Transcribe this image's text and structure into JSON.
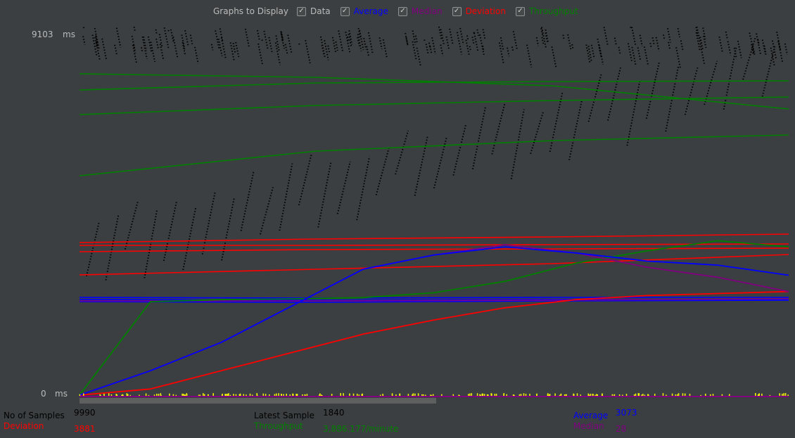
{
  "toolbar": {
    "title": "Graphs to Display",
    "options": [
      {
        "label": "Data",
        "checked": true,
        "color": "#bbbbbb"
      },
      {
        "label": "Average",
        "checked": true,
        "color": "#0000ff"
      },
      {
        "label": "Median",
        "checked": true,
        "color": "#800080"
      },
      {
        "label": "Deviation",
        "checked": true,
        "color": "#ff0000"
      },
      {
        "label": "Throughput",
        "checked": true,
        "color": "#008000"
      }
    ]
  },
  "axis": {
    "max_value": "9103",
    "max_unit": "ms",
    "min_value": "0",
    "min_unit": "ms"
  },
  "stats": {
    "samples_label": "No of Samples",
    "samples_value": "9990",
    "deviation_label": "Deviation",
    "deviation_value": "3881",
    "latest_label": "Latest Sample",
    "latest_value": "1840",
    "throughput_label": "Throughput",
    "throughput_value": "3,886.177/minute",
    "average_label": "Average",
    "average_value": "3073",
    "median_label": "Median",
    "median_value": "28"
  },
  "colors": {
    "background": "#3c3f41",
    "data": "#000000",
    "average": "#0000ff",
    "median": "#800080",
    "deviation": "#ff0000",
    "throughput": "#008000",
    "throughput_text": "#008000",
    "latest_marker": "#ffff00"
  },
  "chart_data": {
    "type": "line",
    "ylim": [
      0,
      9103
    ],
    "y_unit": "ms",
    "series": [
      {
        "name": "Average",
        "values": [
          0,
          600,
          1300,
          2200,
          3100,
          3450,
          3650,
          3500,
          3300,
          3200,
          2950
        ]
      },
      {
        "name": "Median",
        "values": [
          0,
          600,
          1300,
          2200,
          3100,
          3450,
          3700,
          3500,
          3150,
          2900,
          2550
        ]
      },
      {
        "name": "Deviation",
        "values": [
          0,
          150,
          600,
          1050,
          1500,
          1850,
          2150,
          2350,
          2450,
          2500,
          2550
        ]
      },
      {
        "name": "Throughput",
        "values": [
          0,
          2300,
          2350,
          2370,
          2400,
          2520,
          2800,
          3250,
          3550,
          3800,
          3650
        ]
      }
    ]
  }
}
